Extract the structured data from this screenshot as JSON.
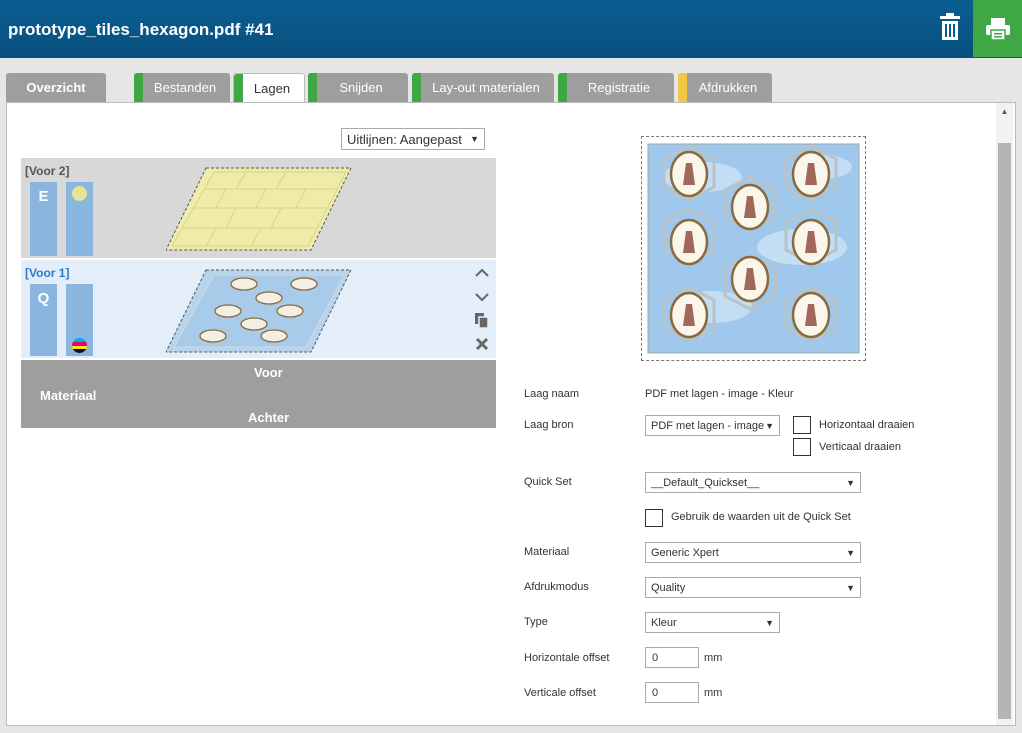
{
  "header": {
    "title": "prototype_tiles_hexagon.pdf #41"
  },
  "tabs": [
    {
      "label": "Overzicht"
    },
    {
      "label": "Bestanden"
    },
    {
      "label": "Lagen"
    },
    {
      "label": "Snijden"
    },
    {
      "label": "Lay-out materialen"
    },
    {
      "label": "Registratie"
    },
    {
      "label": "Afdrukken"
    }
  ],
  "colors": {
    "header": "#0c5e92",
    "tab_green": "#3fa845",
    "tab_yellow": "#f3c644",
    "print_button": "#3fa845"
  },
  "align": {
    "value": "Uitlijnen: Aangepast"
  },
  "layers": [
    {
      "name": "[Voor 2]",
      "letter": "E"
    },
    {
      "name": "[Voor 1]",
      "letter": "Q"
    }
  ],
  "material_bar": {
    "front": "Voor",
    "label": "Materiaal",
    "back": "Achter"
  },
  "form": {
    "layer_name": {
      "label": "Laag naam",
      "value": "PDF met lagen - image - Kleur"
    },
    "layer_source": {
      "label": "Laag bron",
      "value": "PDF met lagen - image"
    },
    "flip_horizontal": {
      "label": "Horizontaal draaien"
    },
    "flip_vertical": {
      "label": "Verticaal draaien"
    },
    "quick_set": {
      "label": "Quick Set",
      "value": "__Default_Quickset__"
    },
    "use_quickset": {
      "label": "Gebruik de waarden uit de Quick Set"
    },
    "material": {
      "label": "Materiaal",
      "value": "Generic Xpert"
    },
    "print_mode": {
      "label": "Afdrukmodus",
      "value": "Quality"
    },
    "type": {
      "label": "Type",
      "value": "Kleur"
    },
    "h_offset": {
      "label": "Horizontale offset",
      "value": "0",
      "unit": "mm"
    },
    "v_offset": {
      "label": "Verticale offset",
      "value": "0",
      "unit": "mm"
    }
  }
}
